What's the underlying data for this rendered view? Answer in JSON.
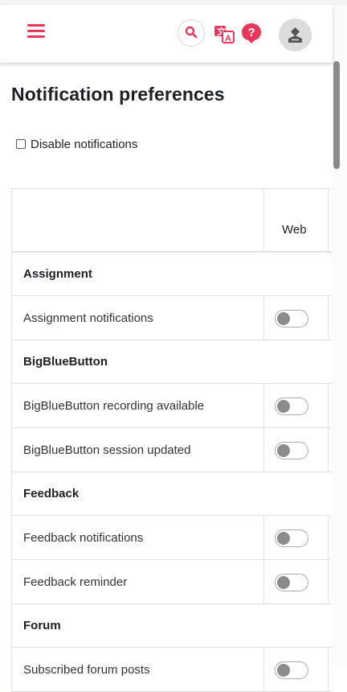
{
  "header": {
    "menu_icon": "hamburger-menu-icon",
    "search_icon": "search-icon",
    "language_icon": "language-translate-icon",
    "help_icon": "help-icon",
    "avatar_icon": "user-avatar-icon",
    "accent_color": "#e8365d"
  },
  "page": {
    "title": "Notification preferences",
    "disable_label": "Disable notifications",
    "disable_checked": false
  },
  "table": {
    "column_headers": [
      "Web"
    ],
    "groups": [
      {
        "name": "Assignment",
        "items": [
          {
            "label": "Assignment notifications",
            "web_enabled": false
          }
        ]
      },
      {
        "name": "BigBlueButton",
        "items": [
          {
            "label": "BigBlueButton recording available",
            "web_enabled": false
          },
          {
            "label": "BigBlueButton session updated",
            "web_enabled": false
          }
        ]
      },
      {
        "name": "Feedback",
        "items": [
          {
            "label": "Feedback notifications",
            "web_enabled": false
          },
          {
            "label": "Feedback reminder",
            "web_enabled": false
          }
        ]
      },
      {
        "name": "Forum",
        "items": [
          {
            "label": "Subscribed forum posts",
            "web_enabled": false
          }
        ]
      }
    ]
  }
}
